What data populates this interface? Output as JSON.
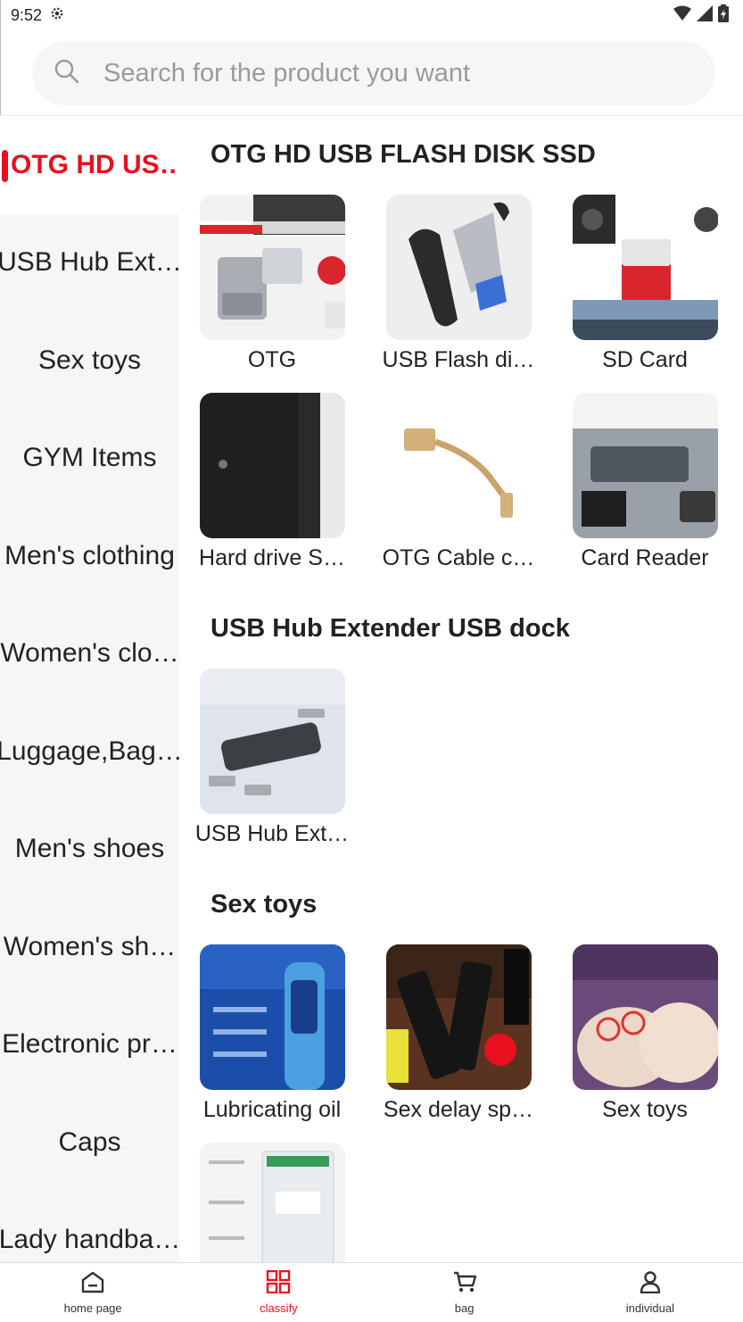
{
  "status_bar": {
    "time": "9:52"
  },
  "search": {
    "placeholder": "Search for the product you want"
  },
  "sidebar": {
    "items": [
      {
        "label": "OTG HD US…",
        "active": true
      },
      {
        "label": "USB Hub Ext…"
      },
      {
        "label": "Sex toys"
      },
      {
        "label": "GYM Items"
      },
      {
        "label": "Men's clothing"
      },
      {
        "label": "Women's clo…"
      },
      {
        "label": "Luggage,Bag…"
      },
      {
        "label": "Men's shoes"
      },
      {
        "label": "Women's sh…"
      },
      {
        "label": "Electronic pr…"
      },
      {
        "label": "Caps"
      },
      {
        "label": "Lady handba…"
      }
    ]
  },
  "sections": [
    {
      "title": "OTG HD USB FLASH DISK SSD",
      "products": [
        {
          "name": "OTG"
        },
        {
          "name": "USB Flash di…"
        },
        {
          "name": "SD Card"
        },
        {
          "name": "Hard drive S…"
        },
        {
          "name": "OTG Cable c…"
        },
        {
          "name": "Card Reader"
        }
      ]
    },
    {
      "title": "USB Hub Extender USB dock",
      "products": [
        {
          "name": "USB Hub Ext…"
        }
      ]
    },
    {
      "title": "Sex toys",
      "products": [
        {
          "name": "Lubricating oil"
        },
        {
          "name": "Sex delay sp…"
        },
        {
          "name": "Sex toys"
        },
        {
          "name": ""
        }
      ]
    }
  ],
  "bottom_nav": {
    "items": [
      {
        "label": "home page",
        "icon": "home-icon"
      },
      {
        "label": "classify",
        "icon": "classify-icon",
        "active": true
      },
      {
        "label": "bag",
        "icon": "cart-icon"
      },
      {
        "label": "individual",
        "icon": "person-icon"
      }
    ]
  },
  "colors": {
    "accent": "#e8101e",
    "sidebar_bg": "#f6f6f6",
    "search_bg": "#f6f6f6"
  }
}
